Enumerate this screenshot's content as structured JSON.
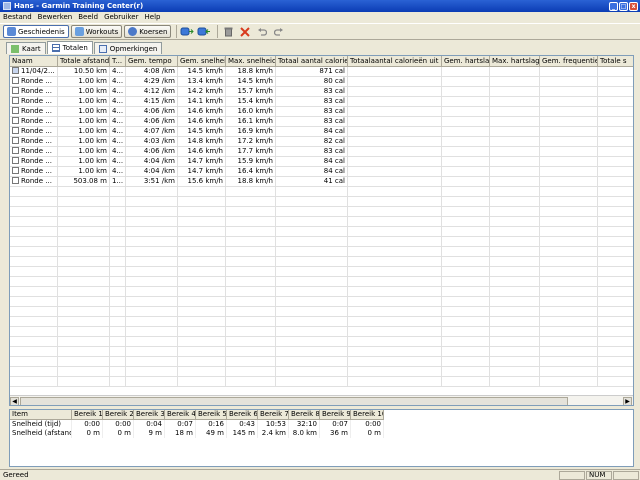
{
  "window": {
    "title": "Hans - Garmin Training Center(r)",
    "minimize": "_",
    "maximize": "□",
    "close": "x"
  },
  "menu": [
    "Bestand",
    "Bewerken",
    "Beeld",
    "Gebruiker",
    "Help"
  ],
  "toolbar": {
    "buttons": [
      {
        "label": "Geschiedenis",
        "icon": "history-icon",
        "active": true
      },
      {
        "label": "Workouts",
        "icon": "workouts-icon",
        "active": false
      },
      {
        "label": "Koersen",
        "icon": "courses-icon",
        "active": false
      }
    ],
    "icons": [
      "receive-device-icon",
      "send-device-icon",
      "trash-icon",
      "delete-icon",
      "undo-icon",
      "redo-icon"
    ]
  },
  "tabs": [
    {
      "label": "Kaart",
      "icon": "map-icon",
      "active": false
    },
    {
      "label": "Totalen",
      "icon": "grid-icon",
      "active": true
    },
    {
      "label": "Opmerkingen",
      "icon": "notes-icon",
      "active": false
    }
  ],
  "table": {
    "columns": [
      "Naam",
      "Totale afstand",
      "T...",
      "Gem. tempo",
      "Gem. snelheid",
      "Max. snelheid",
      "Totaal aantal calorieën",
      "Totaalaantal calorieën uit vetten",
      "Gem. hartslag",
      "Max. hartslag",
      "Gem. frequentie",
      "Totale s"
    ],
    "rows": [
      [
        "11/04/2...",
        "10.50 km",
        "4...",
        "4:08 /km",
        "14.5 km/h",
        "18.8 km/h",
        "871 cal"
      ],
      [
        "Ronde ...",
        "1.00 km",
        "4...",
        "4:29 /km",
        "13.4 km/h",
        "14.5 km/h",
        "80 cal"
      ],
      [
        "Ronde ...",
        "1.00 km",
        "4...",
        "4:12 /km",
        "14.2 km/h",
        "15.7 km/h",
        "83 cal"
      ],
      [
        "Ronde ...",
        "1.00 km",
        "4...",
        "4:15 /km",
        "14.1 km/h",
        "15.4 km/h",
        "83 cal"
      ],
      [
        "Ronde ...",
        "1.00 km",
        "4...",
        "4:06 /km",
        "14.6 km/h",
        "16.0 km/h",
        "83 cal"
      ],
      [
        "Ronde ...",
        "1.00 km",
        "4...",
        "4:06 /km",
        "14.6 km/h",
        "16.1 km/h",
        "83 cal"
      ],
      [
        "Ronde ...",
        "1.00 km",
        "4...",
        "4:07 /km",
        "14.5 km/h",
        "16.9 km/h",
        "84 cal"
      ],
      [
        "Ronde ...",
        "1.00 km",
        "4...",
        "4:03 /km",
        "14.8 km/h",
        "17.2 km/h",
        "82 cal"
      ],
      [
        "Ronde ...",
        "1.00 km",
        "4...",
        "4:06 /km",
        "14.6 km/h",
        "17.7 km/h",
        "83 cal"
      ],
      [
        "Ronde ...",
        "1.00 km",
        "4...",
        "4:04 /km",
        "14.7 km/h",
        "15.9 km/h",
        "84 cal"
      ],
      [
        "Ronde ...",
        "1.00 km",
        "4...",
        "4:04 /km",
        "14.7 km/h",
        "16.4 km/h",
        "84 cal"
      ],
      [
        "Ronde ...",
        "503.08 m",
        "1...",
        "3:51 /km",
        "15.6 km/h",
        "18.8 km/h",
        "41 cal"
      ]
    ]
  },
  "zones": {
    "columns": [
      "Item",
      "Bereik 1",
      "Bereik 2",
      "Bereik 3",
      "Bereik 4",
      "Bereik 5",
      "Bereik 6",
      "Bereik 7",
      "Bereik 8",
      "Bereik 9",
      "Bereik 10"
    ],
    "rows": [
      [
        "Snelheid (tijd)",
        "0:00",
        "0:00",
        "0:04",
        "0:07",
        "0:16",
        "0:43",
        "10:53",
        "32:10",
        "0:07",
        "0:00"
      ],
      [
        "Snelheid (afstand)",
        "0 m",
        "0 m",
        "9 m",
        "18 m",
        "49 m",
        "145 m",
        "2.4 km",
        "8.0 km",
        "36 m",
        "0 m"
      ]
    ]
  },
  "status": {
    "text": "Gereed",
    "panes": [
      "",
      "NUM",
      ""
    ]
  }
}
